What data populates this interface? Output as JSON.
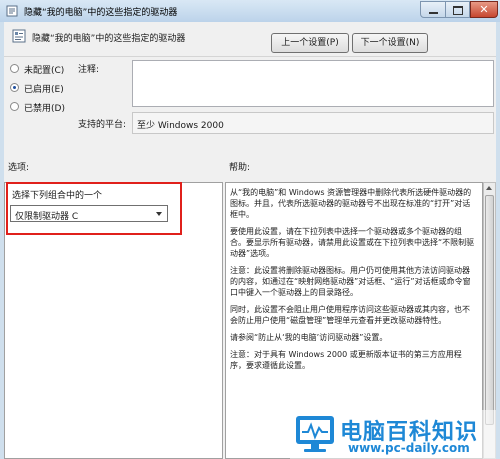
{
  "window": {
    "title": "隐藏“我的电脑”中的这些指定的驱动器"
  },
  "header": {
    "title": "隐藏“我的电脑”中的这些指定的驱动器",
    "prev_button": "上一个设置(P)",
    "next_button": "下一个设置(N)"
  },
  "state": {
    "options": [
      {
        "label": "未配置(C)",
        "selected": false
      },
      {
        "label": "已启用(E)",
        "selected": true
      },
      {
        "label": "已禁用(D)",
        "selected": false
      }
    ],
    "comment_label": "注释:",
    "comment_value": "",
    "platform_label": "支持的平台:",
    "platform_value": "至少 Windows 2000"
  },
  "sections": {
    "options_label": "选项:",
    "help_label": "帮助:"
  },
  "options_panel": {
    "prompt": "选择下列组合中的一个",
    "selected_value": "仅限制驱动器 C"
  },
  "help": {
    "paragraphs": [
      "从“我的电脑”和 Windows 资源管理器中删除代表所选硬件驱动器的图标。并且，代表所选驱动器的驱动器号不出现在标准的“打开”对话框中。",
      "要使用此设置，请在下拉列表中选择一个驱动器或多个驱动器的组合。要显示所有驱动器，请禁用此设置或在下拉列表中选择“不限制驱动器”选项。",
      "注意：此设置将删除驱动器图标。用户仍可使用其他方法访问驱动器的内容，如通过在“映射网络驱动器”对话框、“运行”对话框或命令窗口中键入一个驱动器上的目录路径。",
      "同时，此设置不会阻止用户使用程序访问这些驱动器或其内容，也不会防止用户使用“磁盘管理”管理单元查看并更改驱动器特性。",
      "请参阅“防止从‘我的电脑’访问驱动器”设置。",
      "注意：对于具有 Windows 2000 或更新版本证书的第三方应用程序，要求遵循此设置。"
    ]
  },
  "watermark": {
    "name": "电脑百科知识",
    "url": "www.pc-daily.com"
  },
  "colors": {
    "highlight": "#e0201b",
    "watermark": "#1e88d6",
    "titlebar": "#bcd3ea"
  }
}
